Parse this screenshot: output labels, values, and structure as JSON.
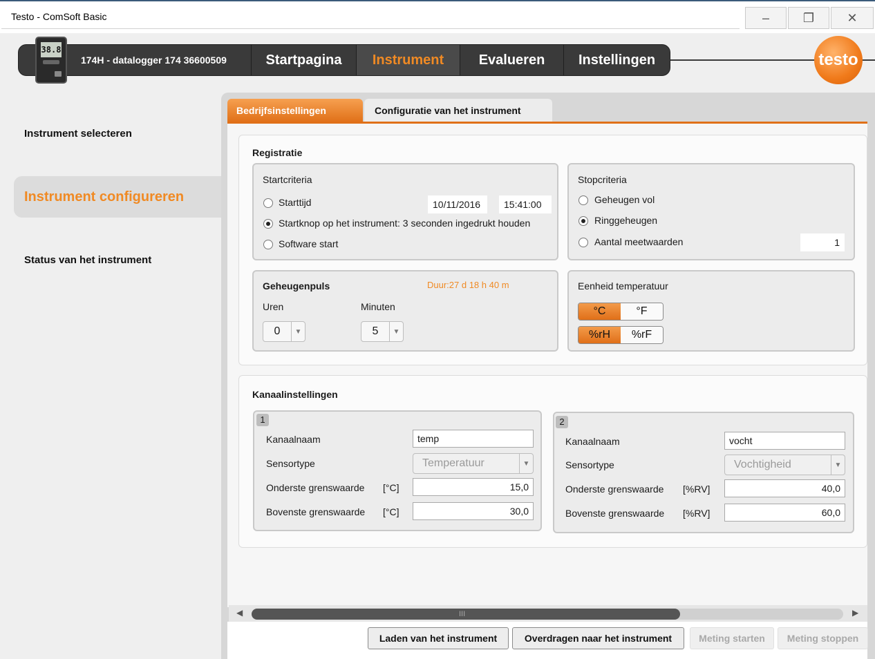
{
  "window": {
    "title": "Testo - ComSoft Basic",
    "controls": {
      "minimize": "–",
      "restore": "❐",
      "close": "✕"
    }
  },
  "header": {
    "device_label": "174H - datalogger 174 36600509",
    "device_display": "38.8",
    "logo_text": "testo",
    "tabs": [
      {
        "label": "Startpagina",
        "active": false
      },
      {
        "label": "Instrument",
        "active": true
      },
      {
        "label": "Evalueren",
        "active": false
      },
      {
        "label": "Instellingen",
        "active": false
      }
    ]
  },
  "sidebar": {
    "items": [
      {
        "label": "Instrument selecteren",
        "active": false
      },
      {
        "label": "Instrument configureren",
        "active": true
      },
      {
        "label": "Status van het instrument",
        "active": false
      }
    ]
  },
  "content_tabs": [
    {
      "label": "Bedrijfsinstellingen",
      "active": true
    },
    {
      "label": "Configuratie van het instrument",
      "active": false
    }
  ],
  "registratie": {
    "title": "Registratie",
    "start": {
      "title": "Startcriteria",
      "options": [
        {
          "label": "Starttijd",
          "selected": false
        },
        {
          "label": "Startknop op het instrument: 3 seconden ingedrukt houden",
          "selected": true
        },
        {
          "label": "Software start",
          "selected": false
        }
      ],
      "date": "10/11/2016",
      "time": "15:41:00"
    },
    "stop": {
      "title": "Stopcriteria",
      "options": [
        {
          "label": "Geheugen vol",
          "selected": false
        },
        {
          "label": "Ringgeheugen",
          "selected": true
        },
        {
          "label": "Aantal meetwaarden",
          "selected": false
        }
      ],
      "count": "1"
    },
    "geheugenpuls": {
      "title": "Geheugenpuls",
      "duration": "Duur:27 d 18 h 40 m",
      "hours_label": "Uren",
      "hours_value": "0",
      "minutes_label": "Minuten",
      "minutes_value": "5"
    },
    "eenheid": {
      "title": "Eenheid temperatuur",
      "temp": [
        "°C",
        "°F"
      ],
      "temp_selected": "°C",
      "humidity": [
        "%rH",
        "%rF"
      ],
      "humidity_selected": "%rH"
    }
  },
  "kanaal": {
    "title": "Kanaalinstellingen",
    "channels": [
      {
        "number": "1",
        "name_label": "Kanaalnaam",
        "name": "temp",
        "sensor_label": "Sensortype",
        "sensor": "Temperatuur",
        "lower_label": "Onderste grenswaarde",
        "upper_label": "Bovenste grenswaarde",
        "unit": "[°C]",
        "lower": "15,0",
        "upper": "30,0"
      },
      {
        "number": "2",
        "name_label": "Kanaalnaam",
        "name": "vocht",
        "sensor_label": "Sensortype",
        "sensor": "Vochtigheid",
        "lower_label": "Onderste grenswaarde",
        "upper_label": "Bovenste grenswaarde",
        "unit": "[%RV]",
        "lower": "40,0",
        "upper": "60,0"
      }
    ]
  },
  "actions": {
    "load": "Laden van het instrument",
    "transfer": "Overdragen naar het instrument",
    "start": "Meting starten",
    "stop": "Meting stoppen"
  },
  "scrollbar": {
    "grip": "III"
  },
  "colors": {
    "accent": "#f08a24",
    "nav_bg": "#3a3a3a"
  }
}
